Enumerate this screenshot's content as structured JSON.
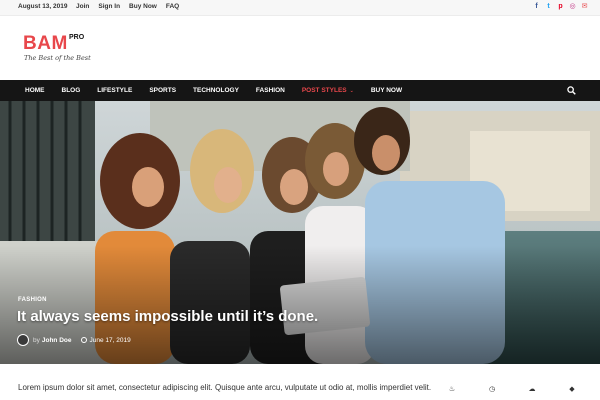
{
  "topbar": {
    "date": "August 13, 2019",
    "links": [
      "Join",
      "Sign In",
      "Buy Now",
      "FAQ"
    ],
    "social": [
      {
        "icon": "facebook-icon",
        "glyph": "f",
        "color": "#3b5998"
      },
      {
        "icon": "twitter-icon",
        "glyph": "t",
        "color": "#1da1f2"
      },
      {
        "icon": "pinterest-icon",
        "glyph": "p",
        "color": "#e60023"
      },
      {
        "icon": "instagram-icon",
        "glyph": "◎",
        "color": "#c13584"
      },
      {
        "icon": "email-icon",
        "glyph": "✉",
        "color": "#e8474b"
      }
    ]
  },
  "header": {
    "logo": "BAM",
    "logo_sup": "PRO",
    "tagline": "The Best of the Best",
    "accent": "#e8474b"
  },
  "nav": {
    "items": [
      "HOME",
      "BLOG",
      "LIFESTYLE",
      "SPORTS",
      "TECHNOLOGY",
      "FASHION",
      "POST STYLES",
      "BUY NOW"
    ],
    "active": "POST STYLES"
  },
  "hero": {
    "category": "FASHION",
    "title": "It always seems impossible until it’s done.",
    "by": "by",
    "author": "John Doe",
    "date": "June 17, 2019"
  },
  "content": {
    "excerpt_line1": "Lorem ipsum dolor sit amet, consectetur adipiscing elit. Quisque ante arcu, vulputate ut odio at, mollis imperdiet velit."
  },
  "sidebar": {
    "tabs": [
      {
        "icon": "flame-icon",
        "glyph": "♨"
      },
      {
        "icon": "clock-icon",
        "glyph": "◷"
      },
      {
        "icon": "comments-icon",
        "glyph": "☁"
      },
      {
        "icon": "tag-icon",
        "glyph": "◆"
      }
    ]
  }
}
